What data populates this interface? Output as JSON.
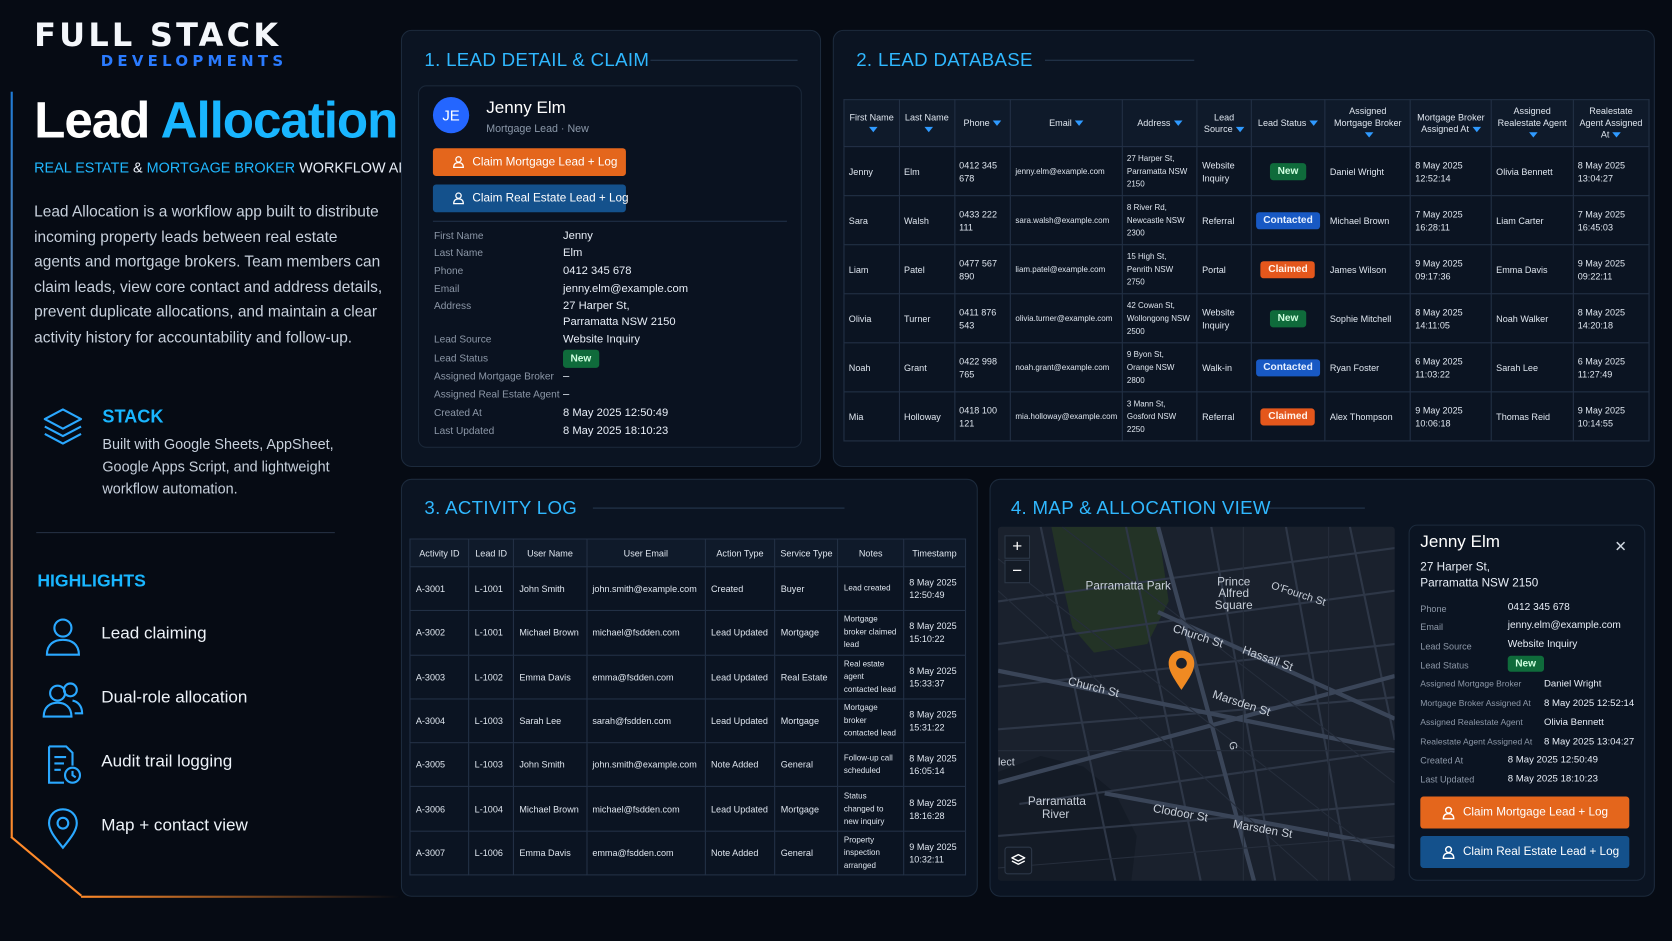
{
  "brand": {
    "top": "FULL STACK",
    "bottom": "DEVELOPMENTS"
  },
  "hero": {
    "title_a": "Lead",
    "title_b": "Allocation",
    "sub_a": "REAL ESTATE",
    "sub_amp": " & ",
    "sub_b": "MORTGAGE BROKER",
    "sub_c": " WORKFLOW APP",
    "description": "Lead Allocation is a workflow app built to distribute incoming property leads between real estate agents and mortgage brokers. Team members can claim leads, view core contact and address details, prevent duplicate allocations, and maintain a clear activity history for accountability and follow-up."
  },
  "stack": {
    "title": "STACK",
    "text": "Built with Google Sheets, AppSheet, Google Apps Script, and lightweight workflow automation.",
    "icon": "layers-icon"
  },
  "highlights": {
    "title": "HIGHLIGHTS",
    "items": [
      {
        "label": "Lead claiming",
        "icon": "user-icon"
      },
      {
        "label": "Dual-role allocation",
        "icon": "users-icon"
      },
      {
        "label": "Audit trail logging",
        "icon": "document-clock-icon"
      },
      {
        "label": "Map + contact view",
        "icon": "location-pin-icon"
      }
    ]
  },
  "panels": {
    "p1": "1.  LEAD DETAIL & CLAIM",
    "p2": "2.  LEAD DATABASE",
    "p3": "3. ACTIVITY LOG",
    "p4": "4.  MAP & ALLOCATION VIEW"
  },
  "lead_card": {
    "initials": "JE",
    "name": "Jenny Elm",
    "subtitle": "Mortgage Lead · New",
    "btn_mortgage": "Claim Mortgage Lead + Log",
    "btn_realestate": "Claim Real Estate Lead + Log",
    "fields": [
      {
        "k": "First Name",
        "v": "Jenny"
      },
      {
        "k": "Last Name",
        "v": "Elm"
      },
      {
        "k": "Phone",
        "v": "0412 345 678"
      },
      {
        "k": "Email",
        "v": "jenny.elm@example.com"
      },
      {
        "k": "Address",
        "v": "27 Harper St,",
        "v2": "Parramatta NSW 2150"
      },
      {
        "k": "Lead Source",
        "v": "Website Inquiry"
      },
      {
        "k": "Lead Status",
        "v": "New"
      },
      {
        "k": "Assigned Mortgage Broker",
        "v": "–"
      },
      {
        "k": "Assigned Real Estate Agent",
        "v": "–"
      },
      {
        "k": "Created At",
        "v": "8 May 2025 12:50:49"
      },
      {
        "k": "Last Updated",
        "v": "8 May 2025 18:10:23"
      }
    ]
  },
  "lead_db": {
    "headers": [
      "First Name",
      "Last Name",
      "Phone",
      "Email",
      "Address",
      "Lead Source",
      "Lead Status",
      "Assigned Mortgage Broker",
      "Mortgage Broker Assigned At",
      "Assigned Realestate Agent",
      "Realestate Agent Assigned At"
    ],
    "rows": [
      [
        "Jenny",
        "Elm",
        "0412 345 678",
        "jenny.elm@example.com",
        "27 Harper St, Parramatta NSW 2150",
        "Website Inquiry",
        "New",
        "Daniel Wright",
        "8 May 2025 12:52:14",
        "Olivia Bennett",
        "8 May 2025 13:04:27"
      ],
      [
        "Sara",
        "Walsh",
        "0433 222 111",
        "sara.walsh@example.com",
        "8 River Rd, Newcastle NSW 2300",
        "Referral",
        "Contacted",
        "Michael Brown",
        "7 May 2025 16:28:11",
        "Liam Carter",
        "7 May 2025 16:45:03"
      ],
      [
        "Liam",
        "Patel",
        "0477 567 890",
        "liam.patel@example.com",
        "15 High St, Penrith NSW 2750",
        "Portal",
        "Claimed",
        "James Wilson",
        "9 May 2025 09:17:36",
        "Emma Davis",
        "9 May 2025 09:22:11"
      ],
      [
        "Olivia",
        "Turner",
        "0411 876 543",
        "olivia.turner@example.com",
        "42 Cowan St, Wollongong NSW 2500",
        "Website Inquiry",
        "New",
        "Sophie Mitchell",
        "8 May 2025 14:11:05",
        "Noah Walker",
        "8 May 2025 14:20:18"
      ],
      [
        "Noah",
        "Grant",
        "0422 998 765",
        "noah.grant@example.com",
        "9 Byon St, Orange NSW 2800",
        "Walk-in",
        "Contacted",
        "Ryan Foster",
        "6 May 2025 11:03:22",
        "Sarah Lee",
        "6 May 2025 11:27:49"
      ],
      [
        "Mia",
        "Holloway",
        "0418 100 121",
        "mia.holloway@example.com",
        "3 Mann St, Gosford NSW 2250",
        "Referral",
        "Claimed",
        "Alex Thompson",
        "9 May 2025 10:06:18",
        "Thomas Reid",
        "9 May 2025 10:14:55"
      ]
    ]
  },
  "activity": {
    "headers": [
      "Activity ID",
      "Lead ID",
      "User Name",
      "User Email",
      "Action Type",
      "Service Type",
      "Notes",
      "Timestamp"
    ],
    "rows": [
      [
        "A-3001",
        "L-1001",
        "John Smith",
        "john.smith@example.com",
        "Created",
        "Buyer",
        "Lead created",
        "8 May 2025 12:50:49"
      ],
      [
        "A-3002",
        "L-1001",
        "Michael Brown",
        "michael@fsdden.com",
        "Lead Updated",
        "Mortgage",
        "Mortgage broker claimed lead",
        "8 May 2025 15:10:22"
      ],
      [
        "A-3003",
        "L-1002",
        "Emma Davis",
        "emma@fsdden.com",
        "Lead Updated",
        "Real Estate",
        "Real estate agent contacted lead",
        "8 May 2025 15:33:37"
      ],
      [
        "A-3004",
        "L-1003",
        "Sarah Lee",
        "sarah@fsdden.com",
        "Lead Updated",
        "Mortgage",
        "Mortgage broker contacted lead",
        "8 May 2025 15:31:22"
      ],
      [
        "A-3005",
        "L-1003",
        "John Smith",
        "john.smith@example.com",
        "Note Added",
        "General",
        "Follow-up call scheduled",
        "8 May 2025 16:05:14"
      ],
      [
        "A-3006",
        "L-1004",
        "Michael Brown",
        "michael@fsdden.com",
        "Lead Updated",
        "Mortgage",
        "Status changed to new inquiry",
        "8 May 2025 18:16:28"
      ],
      [
        "A-3007",
        "L-1006",
        "Emma Davis",
        "emma@fsdden.com",
        "Note Added",
        "General",
        "Property inspection arranged",
        "9 May 2025 10:32:11"
      ]
    ]
  },
  "map": {
    "zoom_in": "+",
    "zoom_out": "−",
    "labels": {
      "park": "Parramatta Park",
      "square": "Prince Alfred Square",
      "church1": "Church St",
      "church2": "Church St",
      "hassall": "Hassall St",
      "marsden1": "Marsden St",
      "marsden2": "Marsden St",
      "river": "Parramatta River",
      "clodoor": "Clodoor St",
      "ofourch": "O'Fourch St",
      "g": "G",
      "lect": "lect"
    }
  },
  "info": {
    "name": "Jenny Elm",
    "addr1": "27 Harper St,",
    "addr2": "Parramatta NSW 2150",
    "close": "✕",
    "fields": [
      {
        "k": "Phone",
        "v": "0412 345 678"
      },
      {
        "k": "Email",
        "v": "jenny.elm@example.com"
      },
      {
        "k": "Lead Source",
        "v": "Website Inquiry"
      },
      {
        "k": "Lead Status",
        "v": "New"
      },
      {
        "k": "Assigned Mortgage Broker",
        "v": "Daniel Wright"
      },
      {
        "k": "Mortgage Broker Assigned At",
        "v": "8 May 2025 12:52:14"
      },
      {
        "k": "Assigned Realestate Agent",
        "v": "Olivia Bennett"
      },
      {
        "k": "Realestate Agent Assigned At",
        "v": "8 May 2025 13:04:27"
      },
      {
        "k": "Created At",
        "v": "8 May 2025 12:50:49"
      },
      {
        "k": "Last Updated",
        "v": "8 May 2025 18:10:23"
      }
    ],
    "btn_mortgage": "Claim Mortgage Lead + Log",
    "btn_realestate": "Claim Real Estate Lead + Log"
  },
  "colors": {
    "accent": "#19b6ff",
    "orange": "#e4661c",
    "blue": "#14518c",
    "new": "#0f6b3b",
    "contacted": "#1859c4",
    "claimed": "#e4571c"
  }
}
